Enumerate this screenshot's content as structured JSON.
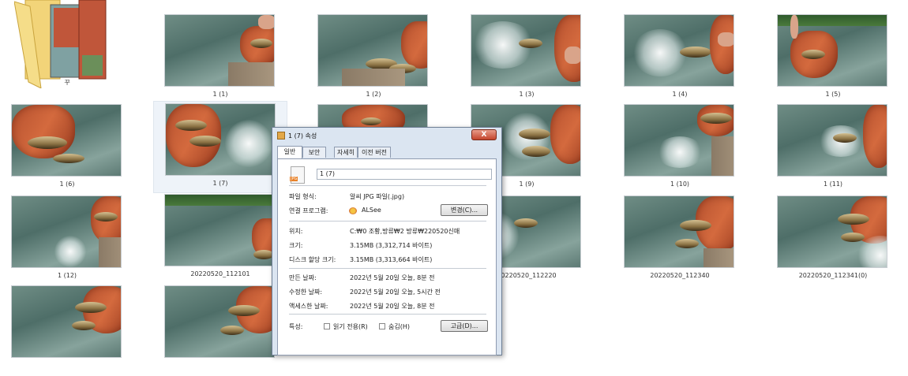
{
  "files": [
    {
      "name": "꾸",
      "kind": "folder"
    },
    {
      "name": "1 (1)"
    },
    {
      "name": "1 (2)"
    },
    {
      "name": "1 (3)"
    },
    {
      "name": "1 (4)"
    },
    {
      "name": "1 (5)"
    },
    {
      "name": "1 (6)"
    },
    {
      "name": "1 (7)",
      "selected": true
    },
    {
      "name": ""
    },
    {
      "name": "1 (9)"
    },
    {
      "name": "1 (10)"
    },
    {
      "name": "1 (11)"
    },
    {
      "name": "1 (12)"
    },
    {
      "name": "20220520_112101"
    },
    {
      "name": ""
    },
    {
      "name": "20220520_112220"
    },
    {
      "name": "20220520_112340"
    },
    {
      "name": "20220520_112341(0)"
    },
    {
      "name": ""
    },
    {
      "name": ""
    }
  ],
  "dialog": {
    "title": "1 (7) 속성",
    "close_symbol": "X",
    "tabs": [
      "일반",
      "보안",
      "자세히",
      "이전 버전"
    ],
    "file_name": "1 (7)",
    "icon_label": "JPG",
    "labels": {
      "type": "파일 형식:",
      "opens_with": "연결 프로그램:",
      "location": "위치:",
      "size": "크기:",
      "size_on_disk": "디스크 할당 크기:",
      "created": "만든 날짜:",
      "modified": "수정한 날짜:",
      "accessed": "액세스한 날짜:",
      "attributes": "특성:"
    },
    "values": {
      "type": "알씨 JPG 파일(.jpg)",
      "opens_with": "ALSee",
      "location": "C:₩0 조황,방류₩2 방류₩220520신매",
      "size": "3.15MB (3,312,714 바이트)",
      "size_on_disk": "3.15MB (3,313,664 바이트)",
      "created": "2022년 5월 20일 오늘, 8분 전",
      "modified": "2022년 5월 20일 오늘, 5시간 전",
      "accessed": "2022년 5월 20일 오늘, 8분 전"
    },
    "buttons": {
      "change": "변경(C)...",
      "advanced": "고급(D)..."
    },
    "checkboxes": {
      "readonly": "읽기 전용(R)",
      "hidden": "숨김(H)"
    }
  }
}
